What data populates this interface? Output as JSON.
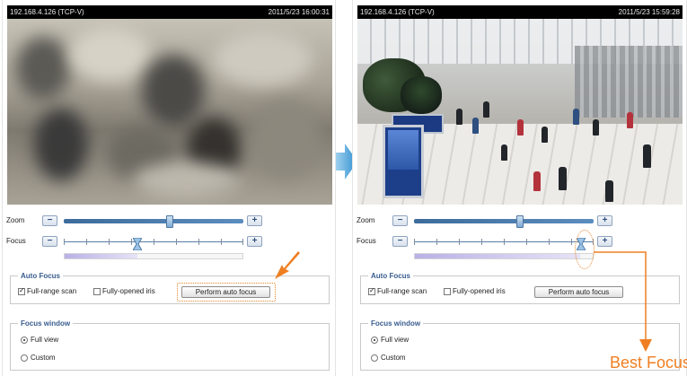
{
  "left": {
    "camera_label": "192.168.4.126 (TCP-V)",
    "timestamp": "2011/5/23 16:00:31",
    "zoom_label": "Zoom",
    "focus_label": "Focus",
    "zoom_level": 0.59,
    "focus_level": 0.41,
    "focus_progress": 0.41,
    "auto_focus_legend": "Auto Focus",
    "full_range_scan": "Full-range scan",
    "full_range_checked": true,
    "fully_opened_iris": "Fully-opened iris",
    "fully_opened_checked": false,
    "perform_button": "Perform auto focus",
    "focus_window_legend": "Focus window",
    "full_view": "Full view",
    "custom": "Custom",
    "selected_window": "Full view"
  },
  "right": {
    "camera_label": "192.168.4.126 (TCP-V)",
    "timestamp": "2011/5/23 15:59:28",
    "zoom_label": "Zoom",
    "focus_label": "Focus",
    "zoom_level": 0.59,
    "focus_level": 0.93,
    "focus_progress": 0.93,
    "auto_focus_legend": "Auto Focus",
    "full_range_scan": "Full-range scan",
    "full_range_checked": true,
    "fully_opened_iris": "Fully-opened iris",
    "fully_opened_checked": false,
    "perform_button": "Perform auto focus",
    "focus_window_legend": "Focus window",
    "full_view": "Full view",
    "custom": "Custom",
    "selected_window": "Full view"
  },
  "annotation": {
    "best_focus": "Best Focus"
  },
  "colors": {
    "accent_orange": "#ef7f22",
    "transition_arrow": "#4aa3d8",
    "slider_blue": "#3d6b9b"
  },
  "icons": [
    "minus-icon",
    "plus-icon",
    "slider-thumb-icon",
    "checkbox-icon",
    "radio-icon",
    "right-arrow-icon",
    "pointer-arrow-icon"
  ]
}
